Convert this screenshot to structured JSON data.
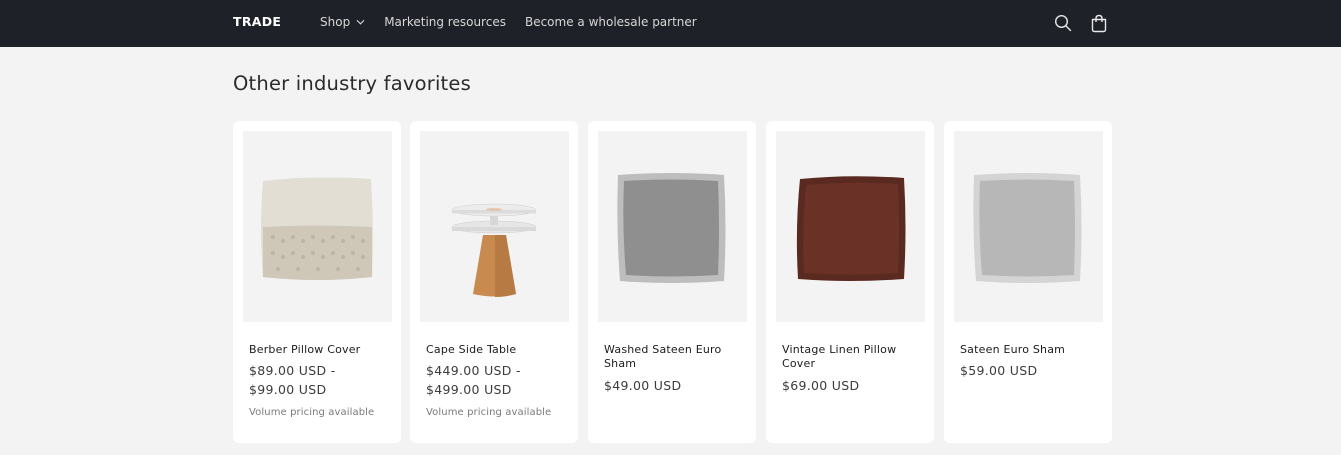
{
  "header": {
    "brand": "TRADE",
    "nav": [
      {
        "label": "Shop",
        "icon": "chevron-down-icon"
      },
      {
        "label": "Marketing resources"
      },
      {
        "label": "Become a wholesale partner"
      }
    ],
    "search_icon": "search-icon",
    "cart_icon": "cart-icon"
  },
  "main": {
    "section_title": "Other industry favorites",
    "products": [
      {
        "title": "Berber Pillow Cover",
        "price_line1": "$89.00 USD -",
        "price_line2": "$99.00 USD",
        "note": "Volume pricing available",
        "image": "pillow-icon"
      },
      {
        "title": "Cape Side Table",
        "price_line1": "$449.00 USD -",
        "price_line2": "$499.00 USD",
        "note": "Volume pricing available",
        "image": "side-table-icon"
      },
      {
        "title_line1": "Washed Sateen Euro",
        "title_line2": "Sham",
        "price": "$49.00 USD",
        "image": "pillow-icon"
      },
      {
        "title_line1": "Vintage Linen Pillow",
        "title_line2": "Cover",
        "price": "$69.00 USD",
        "image": "pillow-icon"
      },
      {
        "title": "Sateen Euro Sham",
        "price": "$59.00 USD",
        "image": "pillow-icon"
      }
    ]
  },
  "colors": {
    "header_bg": "#1e2127",
    "page_bg": "#f3f3f3",
    "card_bg": "#ffffff"
  }
}
